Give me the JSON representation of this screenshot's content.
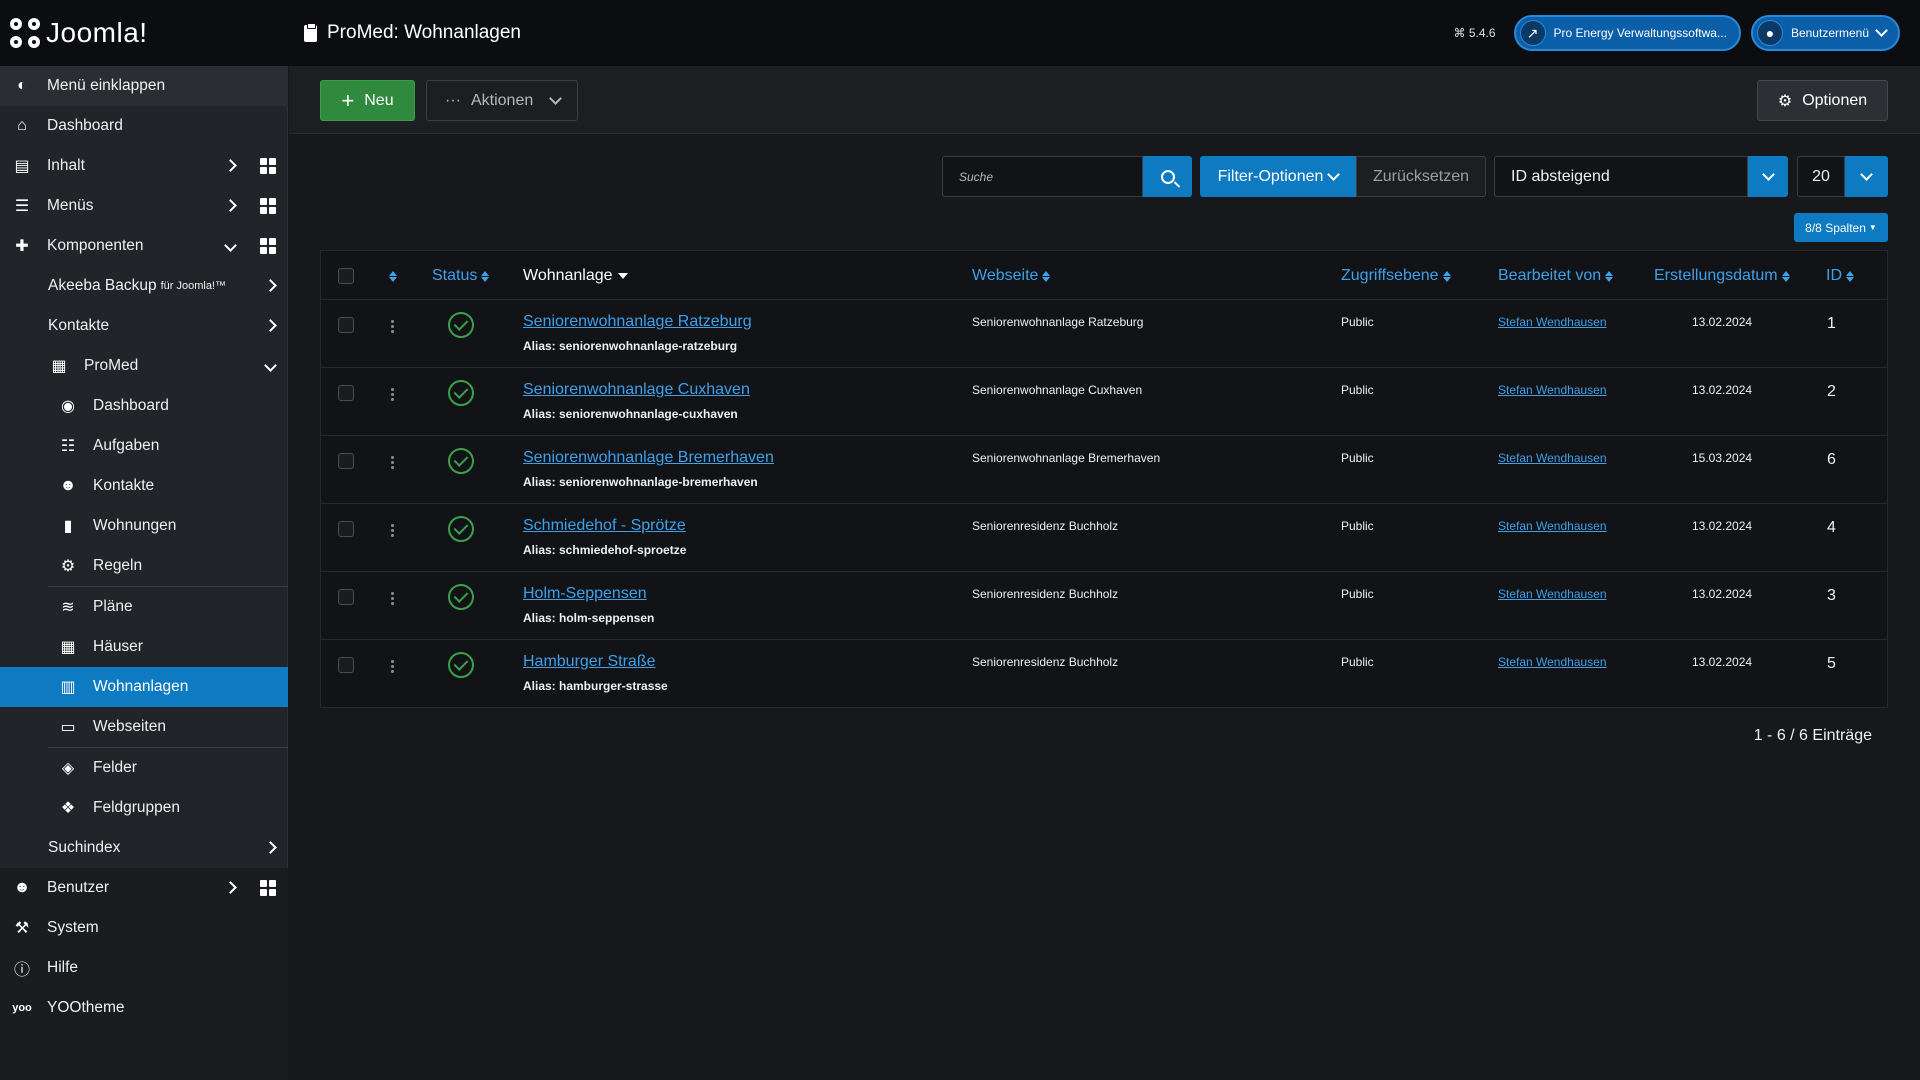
{
  "header": {
    "logo_text": "Joomla!",
    "page_title": "ProMed: Wohnanlagen",
    "version": "⌘ 5.4.6",
    "site_button": "Pro Energy Verwaltungssoftwa...",
    "user_menu": "Benutzermenü"
  },
  "sidebar": {
    "toggle": "Menü einklappen",
    "items": [
      {
        "label": "Dashboard"
      },
      {
        "label": "Inhalt"
      },
      {
        "label": "Menüs"
      },
      {
        "label": "Komponenten"
      },
      {
        "label": "Akeeba Backup",
        "suffix": "für Joomla!™"
      },
      {
        "label": "Kontakte"
      },
      {
        "label": "ProMed"
      },
      {
        "label": "Dashboard"
      },
      {
        "label": "Aufgaben"
      },
      {
        "label": "Kontakte"
      },
      {
        "label": "Wohnungen"
      },
      {
        "label": "Regeln"
      },
      {
        "label": "Pläne"
      },
      {
        "label": "Häuser"
      },
      {
        "label": "Wohnanlagen"
      },
      {
        "label": "Webseiten"
      },
      {
        "label": "Felder"
      },
      {
        "label": "Feldgruppen"
      },
      {
        "label": "Suchindex"
      },
      {
        "label": "Benutzer"
      },
      {
        "label": "System"
      },
      {
        "label": "Hilfe"
      },
      {
        "label": "YOOtheme"
      }
    ]
  },
  "toolbar": {
    "new_label": "Neu",
    "actions_label": "Aktionen",
    "options_label": "Optionen"
  },
  "filters": {
    "search_placeholder": "Suche",
    "filter_options": "Filter-Optionen",
    "reset": "Zurücksetzen",
    "sort": "ID absteigend",
    "limit": "20",
    "columns": "8/8 Spalten"
  },
  "table": {
    "headers": {
      "status": "Status",
      "name": "Wohnanlage",
      "website": "Webseite",
      "access": "Zugriffsebene",
      "editor": "Bearbeitet von",
      "created": "Erstellungsdatum",
      "id": "ID"
    },
    "rows": [
      {
        "name": "Seniorenwohnanlage Ratzeburg",
        "alias": "Alias: seniorenwohnanlage-ratzeburg",
        "website": "Seniorenwohnanlage Ratzeburg",
        "access": "Public",
        "editor": "Stefan Wendhausen",
        "created": "13.02.2024",
        "id": "1"
      },
      {
        "name": "Seniorenwohnanlage Cuxhaven",
        "alias": "Alias: seniorenwohnanlage-cuxhaven",
        "website": "Seniorenwohnanlage Cuxhaven",
        "access": "Public",
        "editor": "Stefan Wendhausen",
        "created": "13.02.2024",
        "id": "2"
      },
      {
        "name": "Seniorenwohnanlage Bremerhaven",
        "alias": "Alias: seniorenwohnanlage-bremerhaven",
        "website": "Seniorenwohnanlage Bremerhaven",
        "access": "Public",
        "editor": "Stefan Wendhausen",
        "created": "15.03.2024",
        "id": "6"
      },
      {
        "name": "Schmiedehof - Sprötze",
        "alias": "Alias: schmiedehof-sproetze",
        "website": "Seniorenresidenz Buchholz",
        "access": "Public",
        "editor": "Stefan Wendhausen",
        "created": "13.02.2024",
        "id": "4"
      },
      {
        "name": "Holm-Seppensen",
        "alias": "Alias: holm-seppensen",
        "website": "Seniorenresidenz Buchholz",
        "access": "Public",
        "editor": "Stefan Wendhausen",
        "created": "13.02.2024",
        "id": "3"
      },
      {
        "name": "Hamburger Straße",
        "alias": "Alias: hamburger-strasse",
        "website": "Seniorenresidenz Buchholz",
        "access": "Public",
        "editor": "Stefan Wendhausen",
        "created": "13.02.2024",
        "id": "5"
      }
    ]
  },
  "pagination": {
    "info": "1 - 6 / 6 Einträge"
  },
  "colors": {
    "accent": "#0d7ac2",
    "link": "#3ea0e8",
    "success": "#2f8a3e",
    "sidebar_bg": "#212428",
    "header_bg": "#0c0d10"
  }
}
